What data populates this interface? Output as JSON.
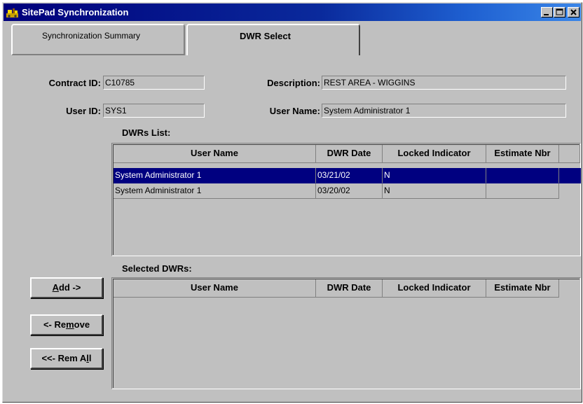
{
  "window": {
    "title": "SitePad Synchronization"
  },
  "tabs": [
    {
      "label": "Synchronization Summary",
      "active": false
    },
    {
      "label": "DWR Select",
      "active": true
    }
  ],
  "form": {
    "contract_id_label": "Contract ID:",
    "contract_id": "C10785",
    "description_label": "Description:",
    "description": "REST AREA - WIGGINS",
    "user_id_label": "User ID:",
    "user_id": "SYS1",
    "user_name_label": "User Name:",
    "user_name": "System Administrator 1"
  },
  "dwrs_list": {
    "label": "DWRs List:",
    "columns": [
      "User Name",
      "DWR Date",
      "Locked Indicator",
      "Estimate Nbr"
    ],
    "rows": [
      {
        "user_name": "System Administrator 1",
        "dwr_date": "03/21/02",
        "locked": "N",
        "estimate": "",
        "selected": true
      },
      {
        "user_name": "System Administrator 1",
        "dwr_date": "03/20/02",
        "locked": "N",
        "estimate": "",
        "selected": false
      }
    ]
  },
  "selected_dwrs": {
    "label": "Selected DWRs:",
    "columns": [
      "User Name",
      "DWR Date",
      "Locked Indicator",
      "Estimate Nbr"
    ],
    "rows": []
  },
  "buttons": {
    "add": {
      "pre": "",
      "key": "A",
      "post": "dd ->"
    },
    "remove": {
      "pre": "<- Re",
      "key": "m",
      "post": "ove"
    },
    "rem_all": {
      "pre": "<<- Rem A",
      "key": "l",
      "post": "l"
    }
  },
  "colors": {
    "selection": "#000080",
    "face": "#c0c0c0",
    "title_start": "#00007b",
    "title_end": "#3a86e8"
  }
}
